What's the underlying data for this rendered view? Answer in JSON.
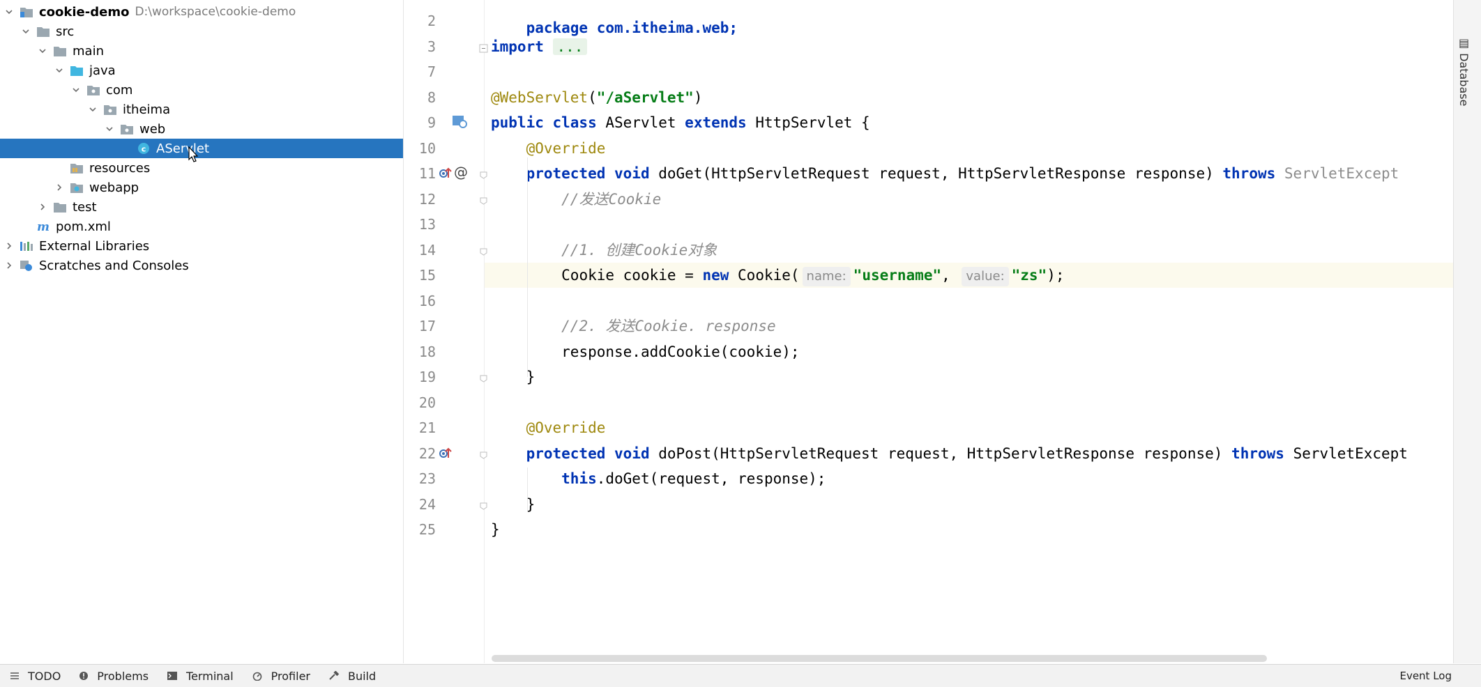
{
  "project_tree": [
    {
      "label": "cookie-demo",
      "path": "D:\\workspace\\cookie-demo",
      "icon": "module-folder-icon",
      "level": 0,
      "expanded": true,
      "bold": true
    },
    {
      "label": "src",
      "icon": "folder-icon",
      "level": 1,
      "expanded": true
    },
    {
      "label": "main",
      "icon": "folder-icon",
      "level": 2,
      "expanded": true
    },
    {
      "label": "java",
      "icon": "source-folder-icon",
      "level": 3,
      "expanded": true
    },
    {
      "label": "com",
      "icon": "package-icon",
      "level": 4,
      "expanded": true
    },
    {
      "label": "itheima",
      "icon": "package-icon",
      "level": 5,
      "expanded": true
    },
    {
      "label": "web",
      "icon": "package-icon",
      "level": 6,
      "expanded": true
    },
    {
      "label": "AServlet",
      "icon": "java-class-icon",
      "level": 7,
      "selected": true
    },
    {
      "label": "resources",
      "icon": "resources-folder-icon",
      "level": 3
    },
    {
      "label": "webapp",
      "icon": "web-folder-icon",
      "level": 3,
      "collapsed": true
    },
    {
      "label": "test",
      "icon": "folder-icon",
      "level": 2,
      "collapsed": true
    },
    {
      "label": "pom.xml",
      "icon": "maven-icon",
      "level": 1
    },
    {
      "label": "External Libraries",
      "icon": "libraries-icon",
      "level": 0,
      "collapsed": true
    },
    {
      "label": "Scratches and Consoles",
      "icon": "scratches-icon",
      "level": 0,
      "collapsed": true
    }
  ],
  "editor": {
    "top_fragment": "package com.itheima.web;",
    "lines": [
      {
        "n": "2"
      },
      {
        "n": "3",
        "tokens": [
          {
            "t": "import ",
            "c": "kw"
          },
          {
            "t": "...",
            "c": "folded"
          }
        ]
      },
      {
        "n": "7"
      },
      {
        "n": "8",
        "tokens": [
          {
            "t": "@WebServlet",
            "c": "ann"
          },
          {
            "t": "(",
            "c": "typ"
          },
          {
            "t": "\"/aServlet\"",
            "c": "str"
          },
          {
            "t": ")",
            "c": "typ"
          }
        ]
      },
      {
        "n": "9",
        "tokens": [
          {
            "t": "public class ",
            "c": "kw"
          },
          {
            "t": "AServlet ",
            "c": "typ"
          },
          {
            "t": "extends ",
            "c": "kw"
          },
          {
            "t": "HttpServlet {",
            "c": "typ"
          }
        ]
      },
      {
        "n": "10",
        "tokens": [
          {
            "t": "    ",
            "c": "typ"
          },
          {
            "t": "@Override",
            "c": "ann"
          }
        ]
      },
      {
        "n": "11",
        "tokens": [
          {
            "t": "    ",
            "c": "typ"
          },
          {
            "t": "protected void ",
            "c": "kw"
          },
          {
            "t": "doGet(HttpServletRequest request, HttpServletResponse response) ",
            "c": "typ"
          },
          {
            "t": "throws ",
            "c": "kw"
          },
          {
            "t": "ServletExcept",
            "c": "dim"
          }
        ]
      },
      {
        "n": "12",
        "tokens": [
          {
            "t": "        ",
            "c": "typ"
          },
          {
            "t": "//发送Cookie",
            "c": "cmt"
          }
        ]
      },
      {
        "n": "13"
      },
      {
        "n": "14",
        "tokens": [
          {
            "t": "        ",
            "c": "typ"
          },
          {
            "t": "//1. 创建Cookie对象",
            "c": "cmt"
          }
        ]
      },
      {
        "n": "15",
        "highlight": true,
        "tokens": [
          {
            "t": "        ",
            "c": "typ"
          },
          {
            "t": "Cookie cookie = ",
            "c": "typ"
          },
          {
            "t": "new ",
            "c": "kw"
          },
          {
            "t": "Cookie(",
            "c": "typ"
          },
          {
            "t": "name:",
            "c": "hint"
          },
          {
            "t": "\"username\"",
            "c": "str"
          },
          {
            "t": ", ",
            "c": "typ"
          },
          {
            "t": "value:",
            "c": "hint"
          },
          {
            "t": "\"zs\"",
            "c": "str"
          },
          {
            "t": ");",
            "c": "typ"
          }
        ]
      },
      {
        "n": "16"
      },
      {
        "n": "17",
        "tokens": [
          {
            "t": "        ",
            "c": "typ"
          },
          {
            "t": "//2. 发送Cookie. response",
            "c": "cmt"
          }
        ]
      },
      {
        "n": "18",
        "tokens": [
          {
            "t": "        ",
            "c": "typ"
          },
          {
            "t": "response.addCookie(cookie);",
            "c": "typ"
          }
        ]
      },
      {
        "n": "19",
        "tokens": [
          {
            "t": "    }",
            "c": "typ"
          }
        ]
      },
      {
        "n": "20"
      },
      {
        "n": "21",
        "tokens": [
          {
            "t": "    ",
            "c": "typ"
          },
          {
            "t": "@Override",
            "c": "ann"
          }
        ]
      },
      {
        "n": "22",
        "tokens": [
          {
            "t": "    ",
            "c": "typ"
          },
          {
            "t": "protected void ",
            "c": "kw"
          },
          {
            "t": "doPost(HttpServletRequest request, HttpServletResponse response) ",
            "c": "typ"
          },
          {
            "t": "throws ",
            "c": "kw"
          },
          {
            "t": "ServletExcept",
            "c": "typ"
          }
        ]
      },
      {
        "n": "23",
        "tokens": [
          {
            "t": "        ",
            "c": "typ"
          },
          {
            "t": "this",
            "c": "kw"
          },
          {
            "t": ".doGet(request, response);",
            "c": "typ"
          }
        ]
      },
      {
        "n": "24",
        "tokens": [
          {
            "t": "    }",
            "c": "typ"
          }
        ]
      },
      {
        "n": "25",
        "tokens": [
          {
            "t": "}",
            "c": "typ"
          }
        ]
      }
    ]
  },
  "right_strip": {
    "database_label": "Database"
  },
  "bottom_bar": {
    "buttons": [
      {
        "label": "TODO",
        "icon": "list-icon"
      },
      {
        "label": "Problems",
        "icon": "problems-icon"
      },
      {
        "label": "Terminal",
        "icon": "terminal-icon"
      },
      {
        "label": "Profiler",
        "icon": "profiler-icon"
      },
      {
        "label": "Build",
        "icon": "hammer-icon"
      }
    ],
    "event_log": "Event Log"
  },
  "colors": {
    "selection": "#2675bf",
    "keyword": "#0033b3",
    "annotation": "#9e880d",
    "string": "#067d17",
    "comment": "#8c8c8c",
    "current_line": "#fcfaed"
  }
}
